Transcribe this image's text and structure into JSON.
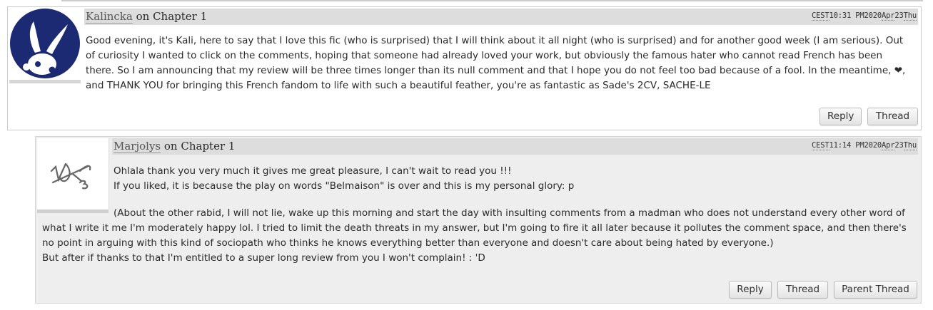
{
  "comments": [
    {
      "author": "Kalincka",
      "on_text": "on Chapter 1",
      "timestamp": {
        "tz": "CEST",
        "time": "10:31 PM",
        "year": "2020",
        "month": "Apr",
        "day": "23",
        "weekday": "Thu"
      },
      "body": "Good evening, it's Kali, here to say that I love this fic (who is surprised) that I will think about it all night (who is surprised) and for another good week (I am serious). Out of curiosity I wanted to click on the comments, hoping that someone had already loved your work, but obviously the famous hater who cannot read French has been there. So I am announcing that my review will be three times longer than its null comment and that I hope you do not feel too bad because of a fool. In the meantime, ❤, and THANK YOU for bringing this French fandom to life with such a beautiful feather, you're as fantastic as Sade's 2CV, SACHE-LE",
      "actions": [
        "Reply",
        "Thread"
      ],
      "avatar_icon": "white-bunny-icon",
      "avatar_color": "#1b2a73"
    },
    {
      "author": "Marjolys",
      "on_text": "on Chapter 1",
      "timestamp": {
        "tz": "CEST",
        "time": "11:14 PM",
        "year": "2020",
        "month": "Apr",
        "day": "23",
        "weekday": "Thu"
      },
      "body_line1": "Ohlala thank you very much it gives me great pleasure, I can't wait to read you !!!",
      "body_line2": "If you liked, it is because the play on words \"Belmaison\" is over and this is my personal glory: p",
      "body_para": "(About the other rabid, I will not lie, wake up this morning and start the day with insulting comments from a madman who does not understand every other word of what I write it me I'm moderately happy lol. I tried to limit the death threats in my answer, but I'm going to fire it all later because it pollutes the comment space, and then there's no point in arguing with this kind of sociopath who thinks he knows everything better than everyone and doesn't care about being hated by everyone.)",
      "body_last": "But after if thanks to that I'm entitled to a super long review from you I won't complain! : 'D",
      "actions": [
        "Reply",
        "Thread",
        "Parent Thread"
      ],
      "avatar_icon": "signature-sketch-icon"
    }
  ]
}
